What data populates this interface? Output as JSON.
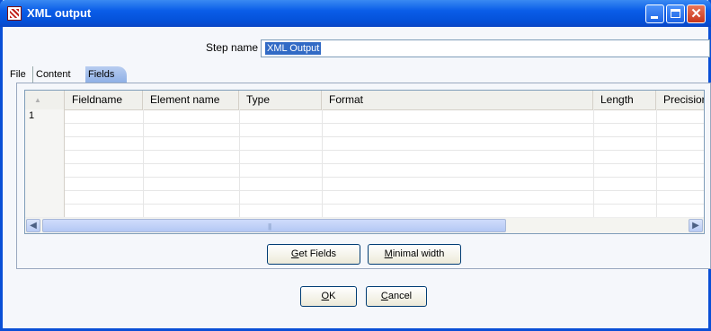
{
  "window": {
    "title": "XML output"
  },
  "step": {
    "label": "Step name",
    "value": "XML Output"
  },
  "tabs": [
    {
      "label": "File"
    },
    {
      "label": "Content"
    },
    {
      "label": "Fields",
      "active": true
    }
  ],
  "table": {
    "columns": [
      "Fieldname",
      "Element name",
      "Type",
      "Format",
      "Length",
      "Precision"
    ],
    "rows": [
      {
        "num": "1"
      }
    ]
  },
  "buttons": {
    "get_fields": {
      "mnemonic": "G",
      "rest": "et Fields"
    },
    "minimal_width": {
      "mnemonic": "M",
      "rest": "inimal width"
    },
    "ok": {
      "mnemonic": "O",
      "rest": "K"
    },
    "cancel": {
      "mnemonic": "C",
      "rest": "ancel"
    }
  },
  "colors": {
    "titlebar": "#0a5de8",
    "selection": "#316ac5",
    "active_tab": "#8fb0e6"
  },
  "icons": [
    "app-icon",
    "minimize-icon",
    "maximize-icon",
    "close-icon",
    "sort-triangle-icon",
    "scroll-left-icon",
    "scroll-right-icon"
  ]
}
